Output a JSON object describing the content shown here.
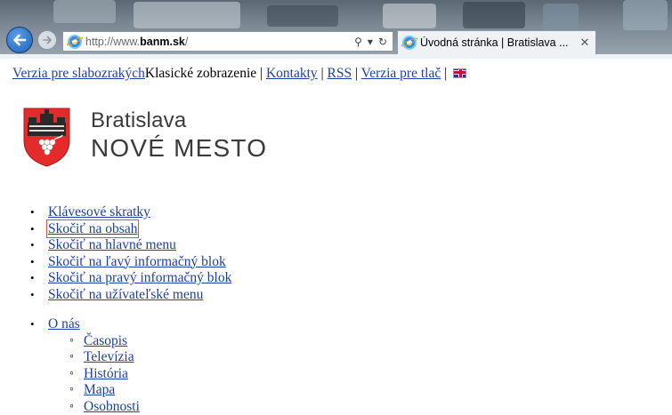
{
  "browser": {
    "url_prefix": "http://www.",
    "url_host": "banm.sk",
    "url_suffix": "/",
    "search_glyph": "⚲",
    "dropdown_glyph": "▾",
    "refresh_glyph": "↻",
    "tab_title": "Úvodná stránka | Bratislava ...",
    "tab_close": "✕",
    "icons": {
      "back": "back-arrow-icon",
      "forward": "forward-arrow-icon",
      "site": "ie-page-icon",
      "search": "search-icon",
      "refresh": "refresh-icon",
      "close": "close-icon"
    }
  },
  "topnav": {
    "items": [
      {
        "label": "Verzia pre slabozrakých",
        "link": true
      },
      {
        "label": "Klasické zobrazenie",
        "link": false
      },
      {
        "label": "Kontakty",
        "link": true
      },
      {
        "label": "RSS",
        "link": true
      },
      {
        "label": "Verzia pre tlač",
        "link": true
      }
    ],
    "separator": "|",
    "flag_icon": "uk-flag-icon"
  },
  "logo": {
    "line1": "Bratislava",
    "line2": "NOVÉ MESTO",
    "crest_colors": {
      "shield": "#e32b2b",
      "castle": "#2a2a2a",
      "grapes": "#ffffff"
    }
  },
  "skip_links": [
    "Klávesové skratky",
    "Skočiť na obsah",
    "Skočiť na hlavné menu",
    "Skočiť na ľavý informačný blok",
    "Skočiť na pravý informačný blok",
    "Skočiť na užívateľské menu"
  ],
  "focused_skip_link_index": 1,
  "main_menu": {
    "label": "O nás",
    "items": [
      "Časopis",
      "Televízia",
      "História",
      "Mapa",
      "Osobnosti"
    ]
  },
  "colors": {
    "link": "#1f3fa8",
    "focus_outline": "#e05050"
  }
}
